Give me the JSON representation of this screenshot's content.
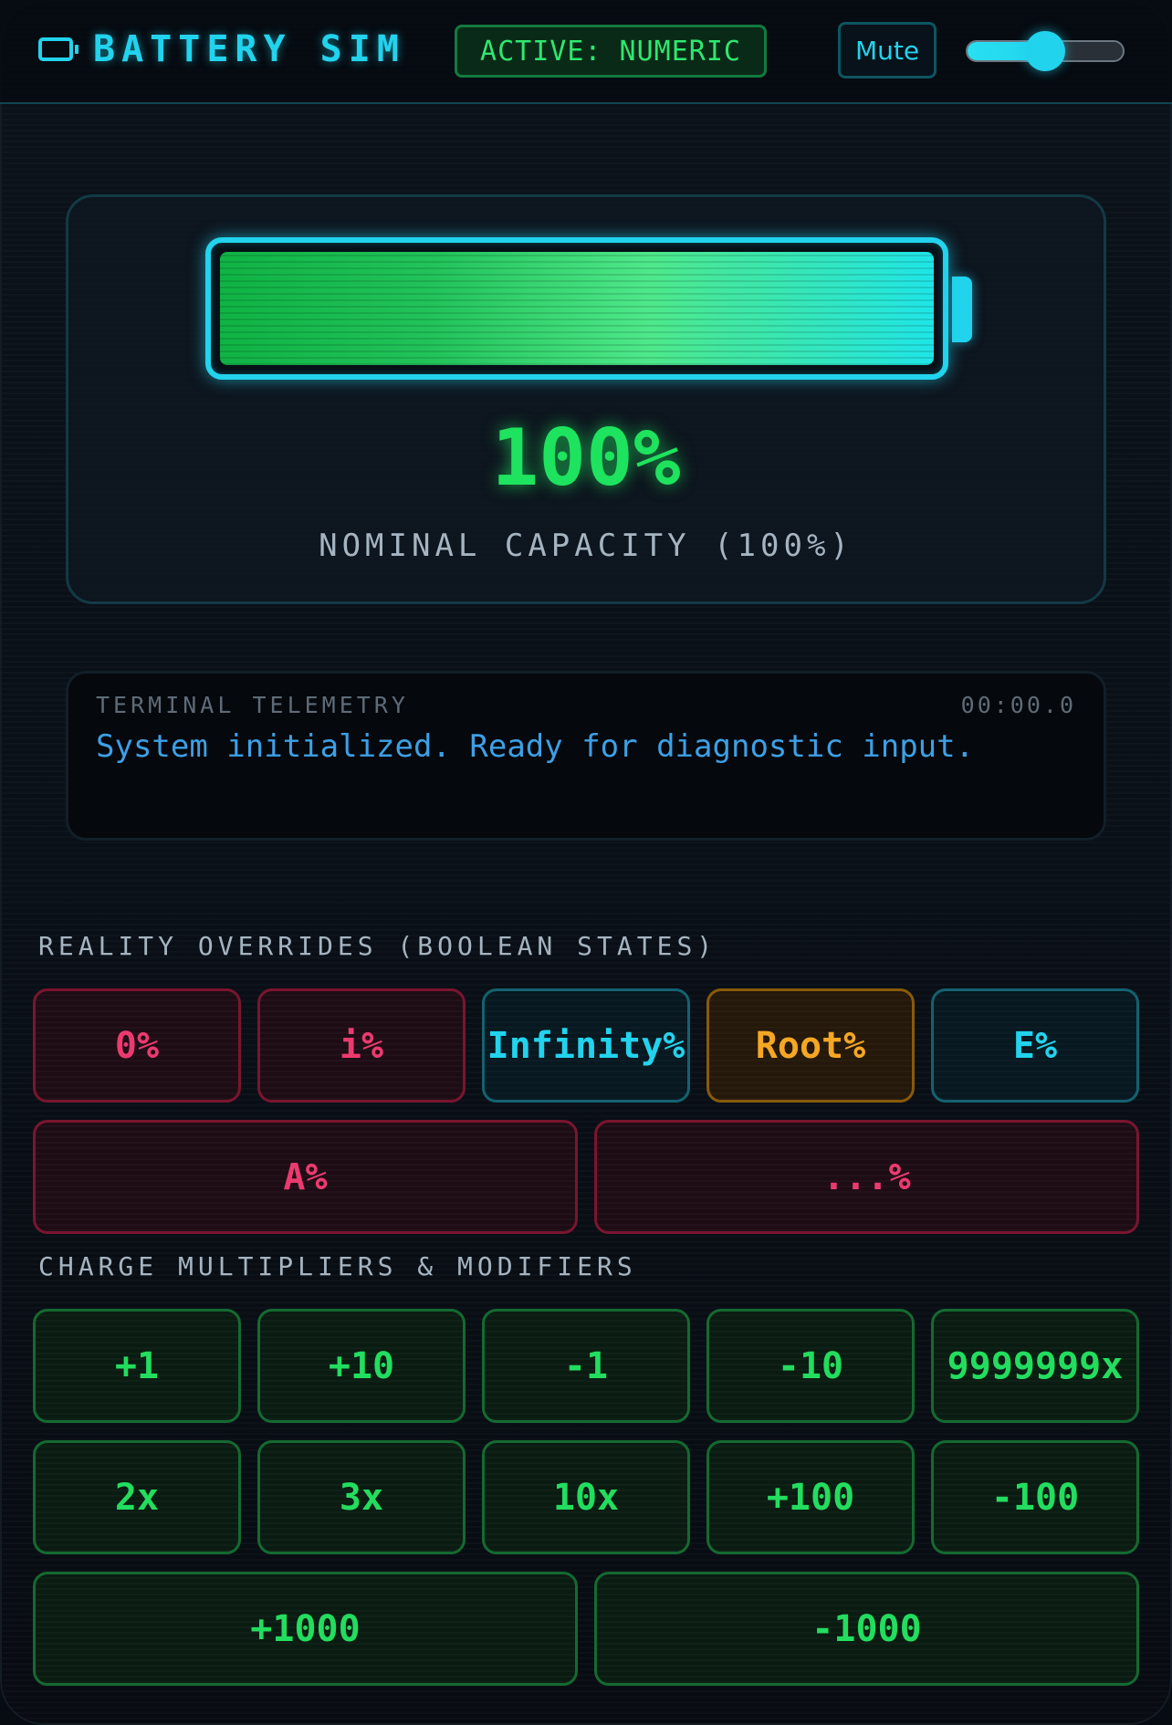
{
  "header": {
    "title": "BATTERY SIM",
    "logo_icon": "battery-icon",
    "mode_badge": "ACTIVE: NUMERIC",
    "mute_label": "Mute",
    "volume_level": 0.5,
    "accent": "#22d3ee"
  },
  "battery": {
    "level": 1.0,
    "percent_text": "100%",
    "status_text": "NOMINAL CAPACITY (100%)",
    "fill_color": "#22c35a"
  },
  "telemetry": {
    "title": "TERMINAL TELEMETRY",
    "timer": "00:00.0",
    "message": "System initialized. Ready for diagnostic input."
  },
  "overrides": {
    "label": "REALITY OVERRIDES (BOOLEAN STATES)",
    "buttons": [
      {
        "label": "0%",
        "style": "red"
      },
      {
        "label": "i%",
        "style": "red"
      },
      {
        "label": "Infinity%",
        "style": "cyan"
      },
      {
        "label": "Root%",
        "style": "amber"
      },
      {
        "label": "E%",
        "style": "cyan"
      },
      {
        "label": "A%",
        "style": "red"
      },
      {
        "label": "...%",
        "style": "red"
      }
    ]
  },
  "modifiers": {
    "label": "CHARGE MULTIPLIERS & MODIFIERS",
    "buttons": [
      {
        "label": "+1"
      },
      {
        "label": "+10"
      },
      {
        "label": "-1"
      },
      {
        "label": "-10"
      },
      {
        "label": "9999999x"
      },
      {
        "label": "2x"
      },
      {
        "label": "3x"
      },
      {
        "label": "10x"
      },
      {
        "label": "+100"
      },
      {
        "label": "-100"
      },
      {
        "label": "+1000"
      },
      {
        "label": "-1000"
      }
    ]
  },
  "colors": {
    "green": "#22dd5e",
    "red": "#ec3a70",
    "cyan": "#22d3ee",
    "amber": "#f5a623",
    "background": "#070b12"
  }
}
